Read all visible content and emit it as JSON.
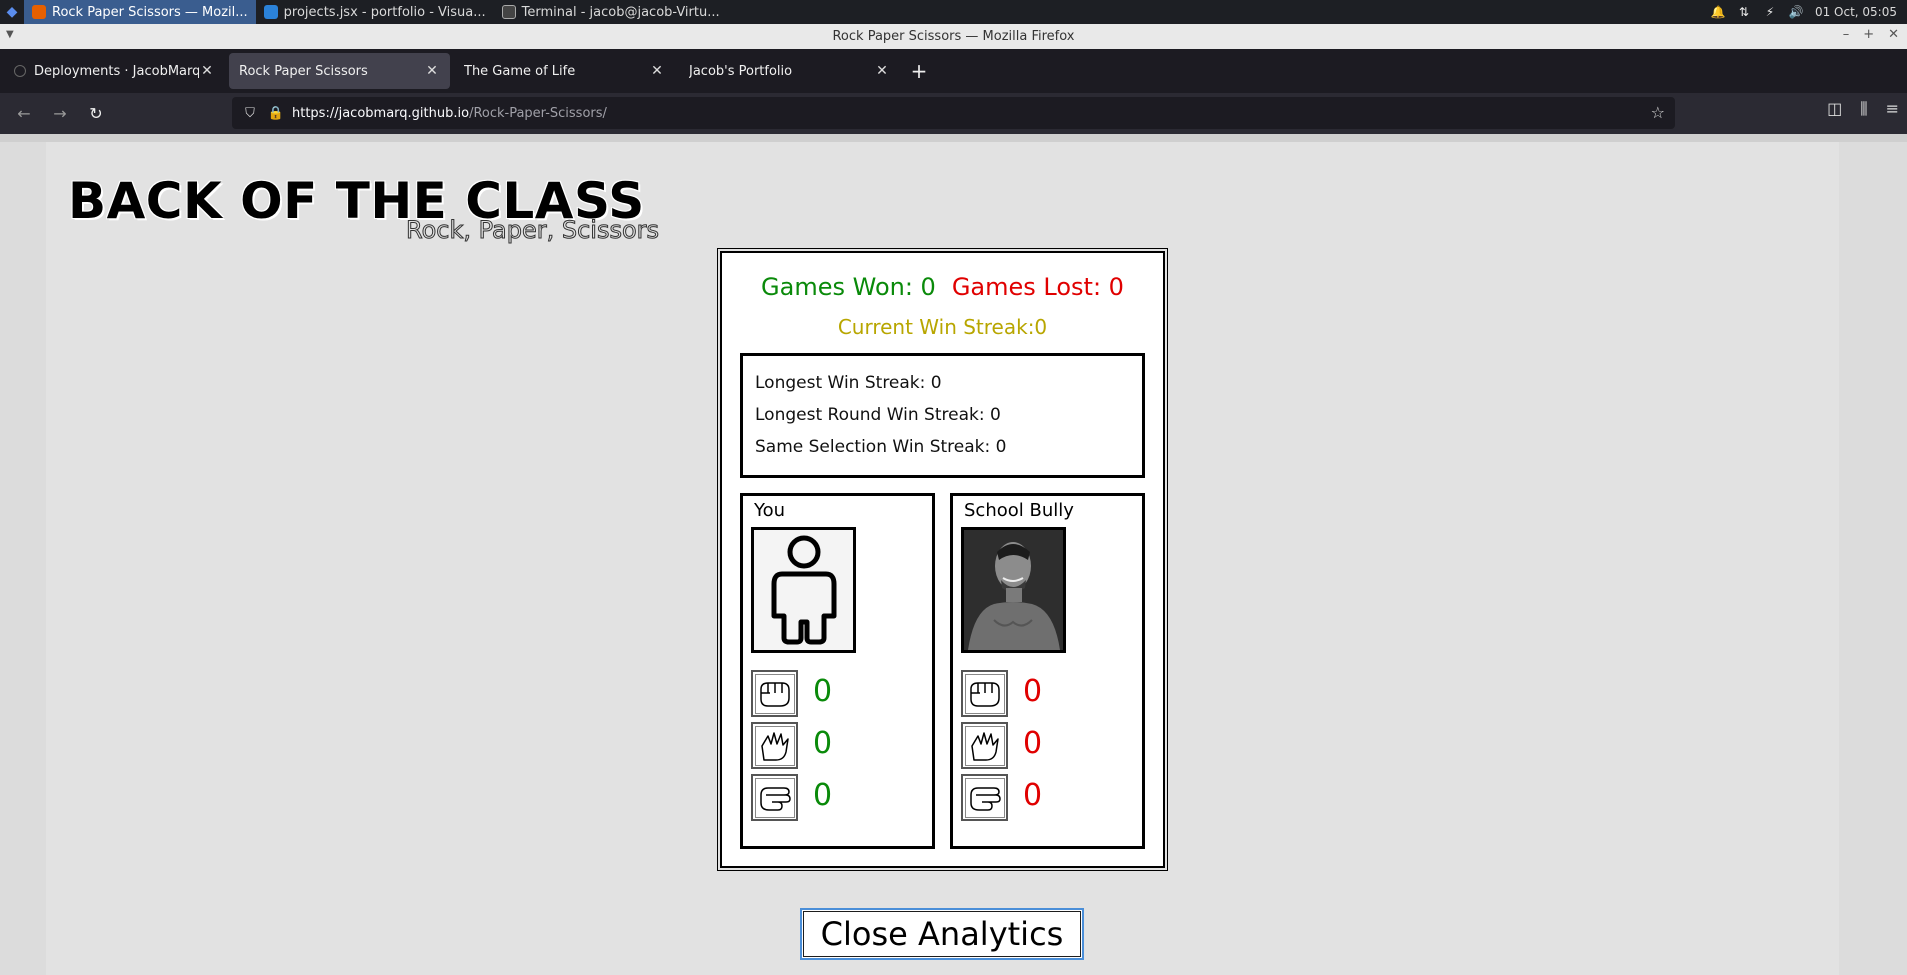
{
  "taskbar": {
    "tasks": [
      {
        "label": "Rock Paper Scissors — Mozil...",
        "active": true
      },
      {
        "label": "projects.jsx - portfolio - Visua..."
      },
      {
        "label": "Terminal - jacob@jacob-Virtu..."
      }
    ],
    "clock": "01 Oct, 05:05"
  },
  "window": {
    "title": "Rock Paper Scissors — Mozilla Firefox"
  },
  "tabs": [
    {
      "label": "Deployments · JacobMarq/Roc",
      "active": false
    },
    {
      "label": "Rock Paper Scissors",
      "active": true
    },
    {
      "label": "The Game of Life",
      "active": false
    },
    {
      "label": "Jacob's Portfolio",
      "active": false
    }
  ],
  "url": {
    "host": "https://jacobmarq.github.io",
    "path": "/Rock-Paper-Scissors/"
  },
  "page": {
    "title": "BACK OF THE CLASS",
    "subtitle": "Rock, Paper, Scissors",
    "games_won": "Games Won: 0",
    "games_lost": "Games Lost: 0",
    "current_streak": "Current Win Streak:0",
    "stats": [
      "Longest Win Streak: 0",
      "Longest Round Win Streak: 0",
      "Same Selection Win Streak: 0"
    ],
    "players": {
      "you": {
        "name": "You",
        "counts": [
          "0",
          "0",
          "0"
        ]
      },
      "bully": {
        "name": "School Bully",
        "counts": [
          "0",
          "0",
          "0"
        ]
      }
    },
    "close_button": "Close Analytics"
  },
  "colors": {
    "won": "#0a8a0a",
    "lost": "#e00000",
    "streak": "#b8a600"
  }
}
